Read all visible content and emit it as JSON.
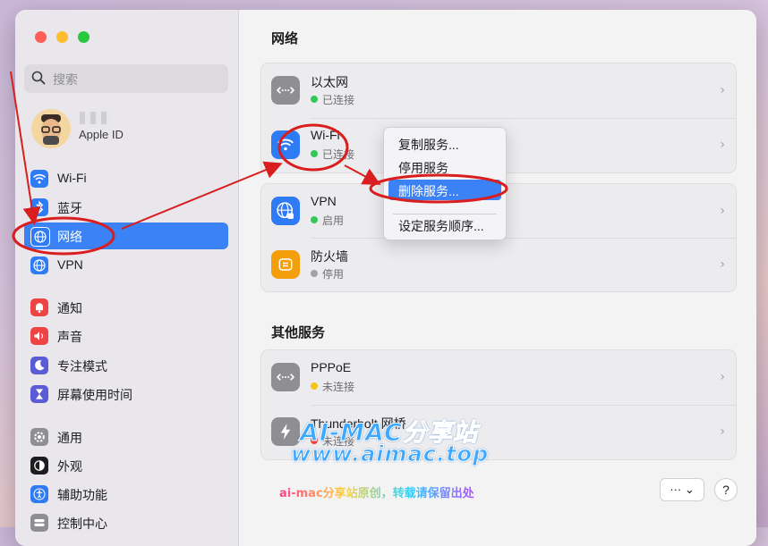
{
  "window": {
    "search_placeholder": "搜索",
    "account_label": "Apple ID"
  },
  "sidebar": {
    "items": [
      {
        "label": "Wi-Fi",
        "icon": "wifi-icon",
        "color": "#2f7bf5"
      },
      {
        "label": "蓝牙",
        "icon": "bluetooth-icon",
        "color": "#2f7bf5"
      },
      {
        "label": "网络",
        "icon": "globe-icon",
        "color": "#2f7bf5",
        "active": true
      },
      {
        "label": "VPN",
        "icon": "vpn-globe-icon",
        "color": "#2f7bf5"
      },
      {
        "label": "通知",
        "icon": "bell-icon",
        "color": "#ef4444"
      },
      {
        "label": "声音",
        "icon": "speaker-icon",
        "color": "#ef4444"
      },
      {
        "label": "专注模式",
        "icon": "moon-icon",
        "color": "#5b5bd6"
      },
      {
        "label": "屏幕使用时间",
        "icon": "hourglass-icon",
        "color": "#5b5bd6"
      },
      {
        "label": "通用",
        "icon": "gear-icon",
        "color": "#8e8e93"
      },
      {
        "label": "外观",
        "icon": "appearance-icon",
        "color": "#1d1d1f"
      },
      {
        "label": "辅助功能",
        "icon": "accessibility-icon",
        "color": "#2f7bf5"
      },
      {
        "label": "控制中心",
        "icon": "control-center-icon",
        "color": "#8e8e93"
      }
    ]
  },
  "main": {
    "title": "网络",
    "services": [
      {
        "name": "以太网",
        "status": "已连接",
        "status_color": "#34c759",
        "icon": "ethernet-icon"
      },
      {
        "name": "Wi-Fi",
        "status": "已连接",
        "status_color": "#34c759",
        "icon": "wifi-icon"
      },
      {
        "name": "VPN",
        "status": "启用",
        "status_color": "#34c759",
        "icon": "vpn-globe-icon"
      },
      {
        "name": "防火墙",
        "status": "停用",
        "status_color": "#a1a1a6",
        "icon": "firewall-icon"
      }
    ],
    "other_title": "其他服务",
    "other_services": [
      {
        "name": "PPPoE",
        "status": "未连接",
        "status_color": "#f5c518",
        "icon": "ethernet-icon"
      },
      {
        "name": "Thunderbolt 网桥",
        "status": "未连接",
        "status_color": "#ff3b30",
        "icon": "thunderbolt-icon"
      }
    ],
    "more_button": "··· ⌄",
    "help_button": "?"
  },
  "context_menu": {
    "items": [
      "复制服务...",
      "停用服务",
      "删除服务...",
      "设定服务顺序..."
    ],
    "highlighted": "删除服务..."
  },
  "watermark": {
    "line1": "AI-MAC分享站",
    "line2": "www.aimac.top",
    "line3": "ai-mac分享站原创，转载请保留出处"
  }
}
